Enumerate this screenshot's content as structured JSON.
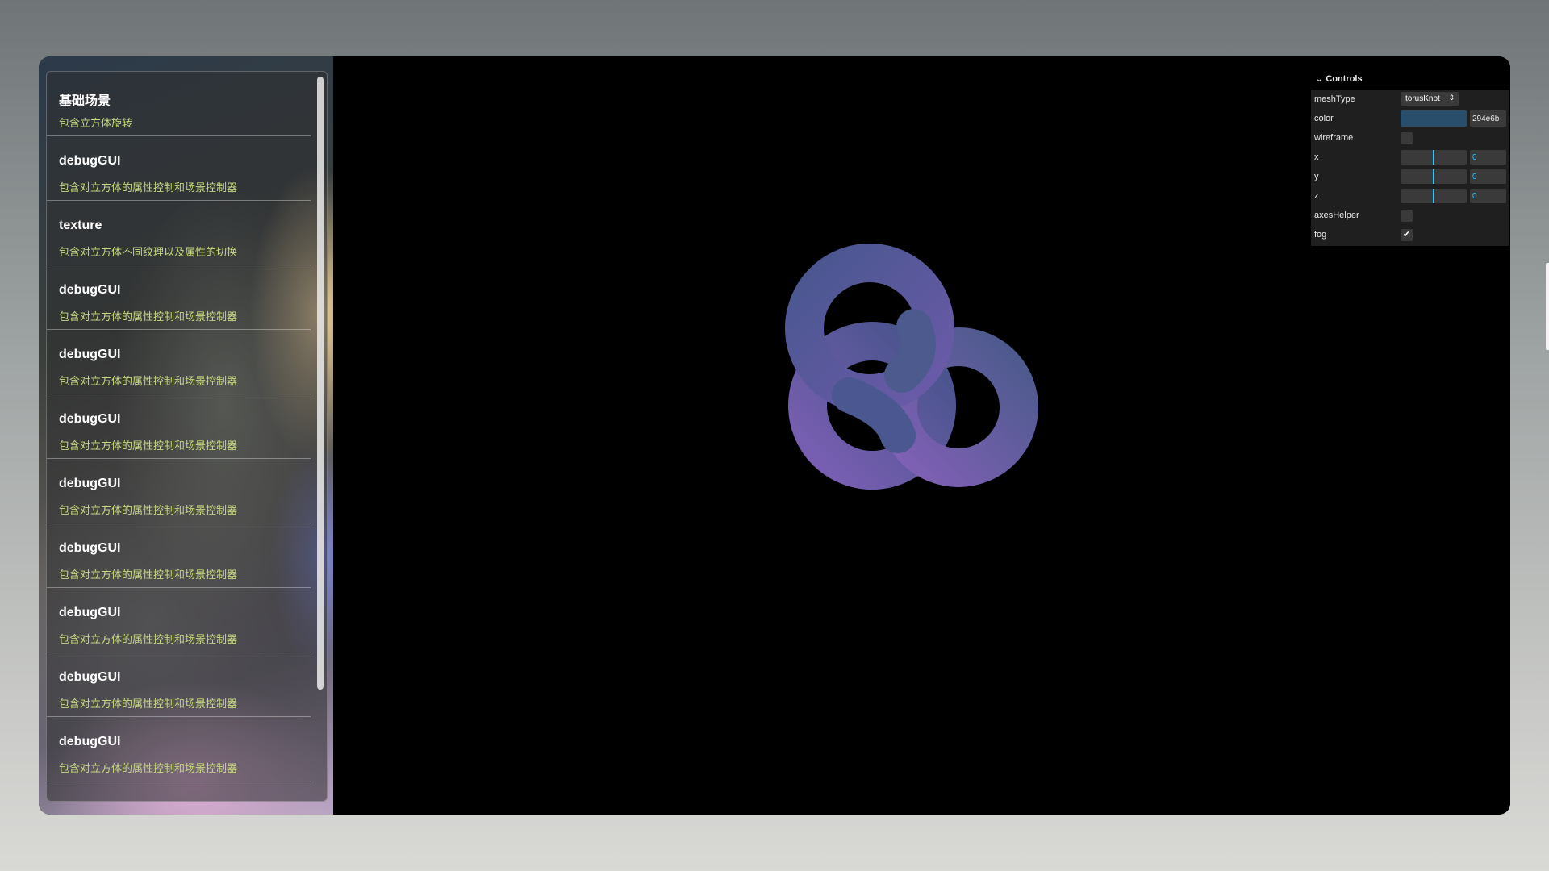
{
  "sidebar": {
    "items": [
      {
        "title": "基础场景",
        "desc": "包含立方体旋转"
      },
      {
        "title": "debugGUI",
        "desc": "包含对立方体的属性控制和场景控制器"
      },
      {
        "title": "texture",
        "desc": "包含对立方体不同纹理以及属性的切换"
      },
      {
        "title": "debugGUI",
        "desc": "包含对立方体的属性控制和场景控制器"
      },
      {
        "title": "debugGUI",
        "desc": "包含对立方体的属性控制和场景控制器"
      },
      {
        "title": "debugGUI",
        "desc": "包含对立方体的属性控制和场景控制器"
      },
      {
        "title": "debugGUI",
        "desc": "包含对立方体的属性控制和场景控制器"
      },
      {
        "title": "debugGUI",
        "desc": "包含对立方体的属性控制和场景控制器"
      },
      {
        "title": "debugGUI",
        "desc": "包含对立方体的属性控制和场景控制器"
      },
      {
        "title": "debugGUI",
        "desc": "包含对立方体的属性控制和场景控制器"
      },
      {
        "title": "debugGUI",
        "desc": "包含对立方体的属性控制和场景控制器"
      }
    ]
  },
  "gui": {
    "title": "Controls",
    "meshType": {
      "label": "meshType",
      "value": "torusKnot"
    },
    "color": {
      "label": "color",
      "hex": "294e6b",
      "swatch": "#294e6b"
    },
    "wireframe": {
      "label": "wireframe",
      "checked": false
    },
    "x": {
      "label": "x",
      "value": "0"
    },
    "y": {
      "label": "y",
      "value": "0"
    },
    "z": {
      "label": "z",
      "value": "0"
    },
    "axesHelper": {
      "label": "axesHelper",
      "checked": false
    },
    "fog": {
      "label": "fog",
      "checked": true,
      "mark": "✔"
    }
  },
  "colors": {
    "desc_text": "#c6d87e",
    "slider_accent": "#2cc9ff",
    "knot_blue": "#465487",
    "knot_purple": "#7a5cb0"
  }
}
